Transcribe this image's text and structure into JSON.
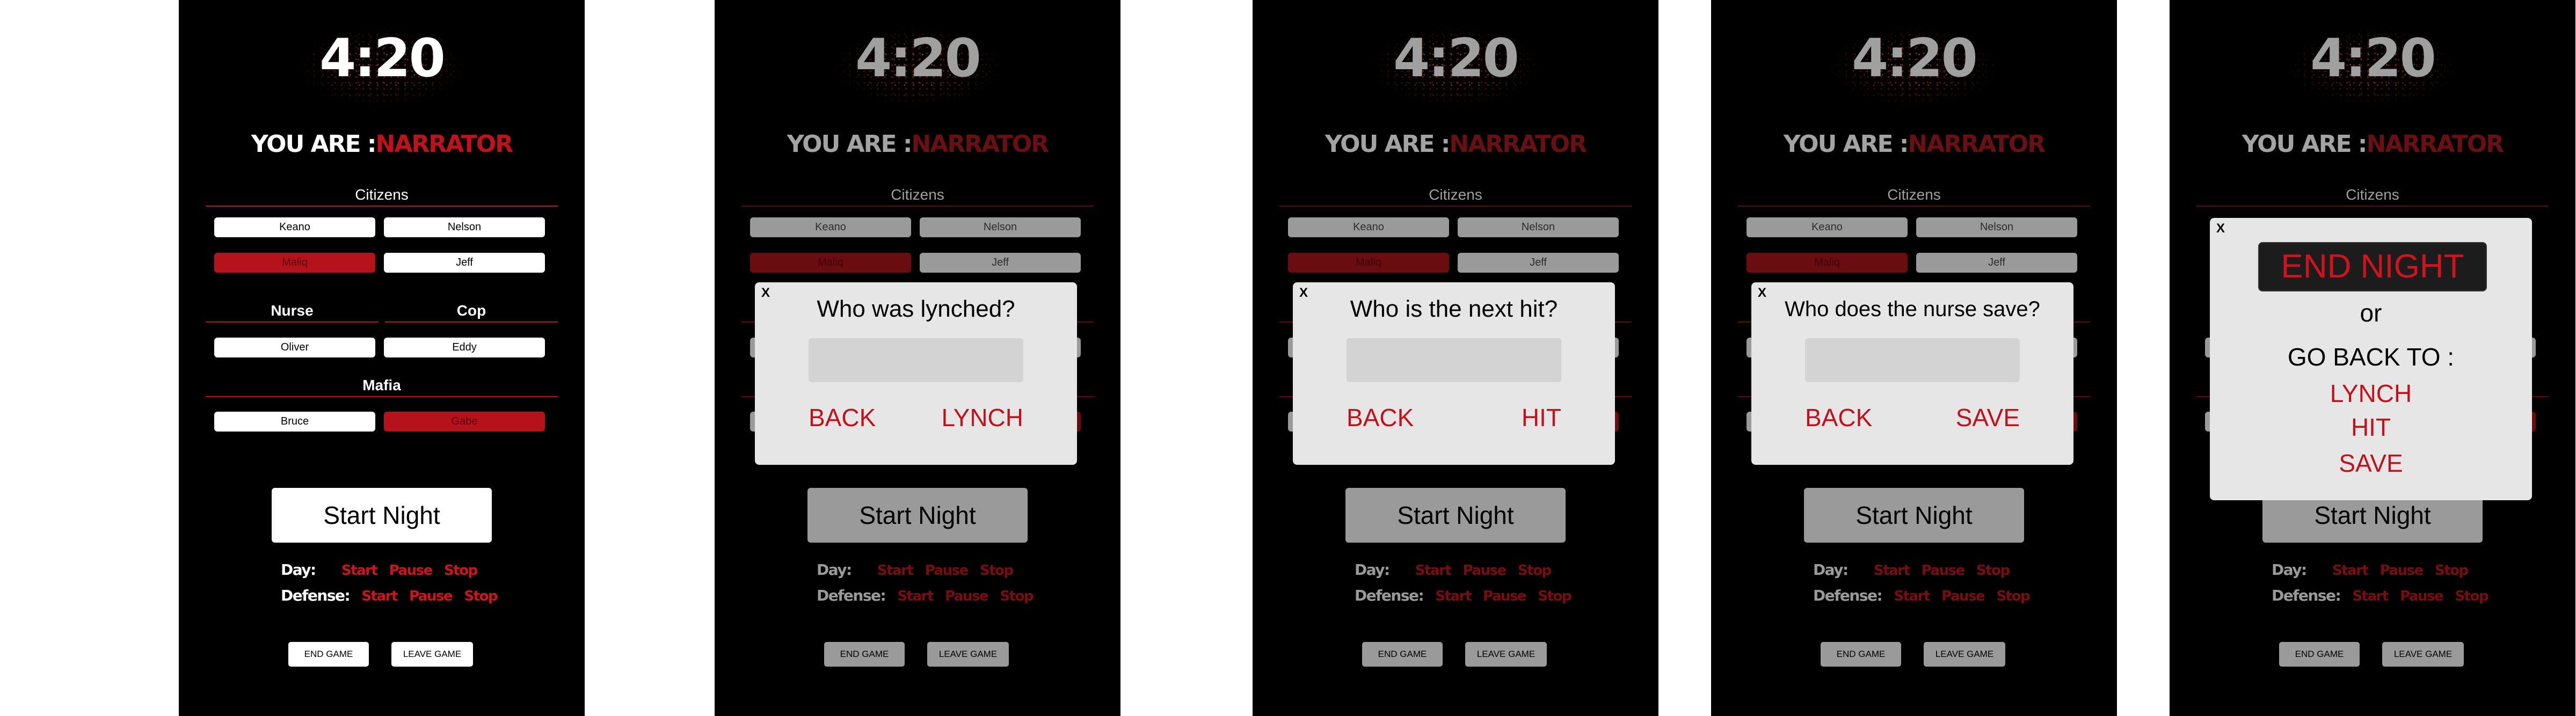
{
  "timer": "4:20",
  "role_prefix": "YOU ARE :",
  "role": "NARRATOR",
  "citizens_title": "Citizens",
  "citizens": [
    "Keano",
    "Nelson",
    "Maliq",
    "Jeff"
  ],
  "nurse_title": "Nurse",
  "nurse": "Oliver",
  "cop_title": "Cop",
  "cop": "Eddy",
  "mafia_title": "Mafia",
  "mafia": [
    "Bruce",
    "Gabe"
  ],
  "start_night": "Start Night",
  "day_label": "Day:",
  "defense_label": "Defense:",
  "ctrl_start": "Start",
  "ctrl_pause": "Pause",
  "ctrl_stop": "Stop",
  "end_game": "END GAME",
  "leave_game": "LEAVE GAME",
  "close_x": "X",
  "back": "BACK",
  "modal_lynch": {
    "question": "Who was lynched?",
    "action": "LYNCH"
  },
  "modal_hit": {
    "question": "Who is the next hit?",
    "action": "HIT"
  },
  "modal_save": {
    "question": "Who does the nurse save?",
    "action": "SAVE"
  },
  "modal_end": {
    "end_night": "END NIGHT",
    "or": "or",
    "go_back": "GO BACK TO :",
    "options": [
      "LYNCH",
      "HIT",
      "SAVE"
    ]
  },
  "colors": {
    "accent_red": "#c1121c",
    "background": "#000000",
    "modal_bg": "#e6e6e6"
  }
}
